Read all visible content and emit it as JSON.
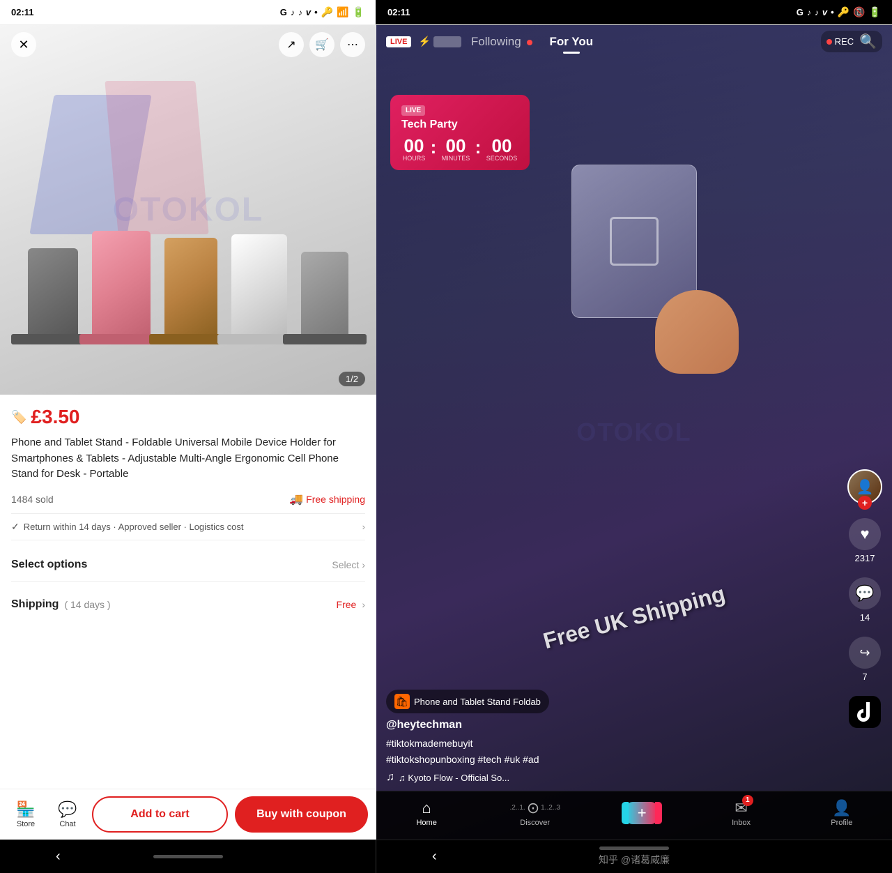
{
  "status_bar": {
    "time": "02:11",
    "icons": [
      "G",
      "tiktok1",
      "tiktok2",
      "v",
      "dot"
    ]
  },
  "left_screen": {
    "toolbar": {
      "close_label": "×",
      "share_label": "↗",
      "cart_label": "🛒",
      "more_label": "⋯"
    },
    "image": {
      "counter": "1/2"
    },
    "product": {
      "price": "£3.50",
      "title": "Phone and Tablet Stand - Foldable Universal Mobile Device Holder for Smartphones & Tablets - Adjustable Multi-Angle Ergonomic Cell Phone Stand for Desk - Portable",
      "sold_count": "1484 sold",
      "free_shipping": "Free shipping",
      "return_policy": "Return within 14 days · Approved seller · Logistics cost",
      "select_options_label": "Select options",
      "select_action": "Select",
      "shipping_label": "Shipping",
      "shipping_days": "( 14 days )",
      "shipping_free": "Free"
    },
    "bottom_bar": {
      "store_label": "Store",
      "chat_label": "Chat",
      "add_to_cart": "Add to cart",
      "buy_with_coupon": "Buy with coupon"
    }
  },
  "right_screen": {
    "header": {
      "live_label": "LIVE",
      "following_label": "Following",
      "for_you_label": "For You",
      "rec_label": "REC"
    },
    "tech_party": {
      "live_label": "LIVE",
      "title": "Tech Party",
      "hours": "00",
      "minutes": "00",
      "seconds": "00",
      "hours_label": "HOURS",
      "minutes_label": "MINUTES",
      "seconds_label": "SECONDS"
    },
    "free_shipping_text": "Free UK Shipping",
    "side_actions": {
      "like_count": "2317",
      "comment_count": "14",
      "share_count": "7"
    },
    "product_chip": {
      "text": "Phone and Tablet Stand  Foldab"
    },
    "username": "@heytechman",
    "hashtags": "#tiktokmademebuyit\n#tiktokshopunboxing #tech #uk #ad",
    "music": "♫  Kyoto Flow - Official So...",
    "bottom_nav": {
      "home_label": "Home",
      "discover_label": "Discover",
      "inbox_label": "Inbox",
      "inbox_badge": "1",
      "profile_label": "Profile",
      "discover_numbers": ".2..1.",
      "discover_numbers2": "1..2..3"
    }
  },
  "bottom": {
    "zhihu_text": "知乎 @诸葛威廉"
  },
  "watermark": "OTOKOL"
}
